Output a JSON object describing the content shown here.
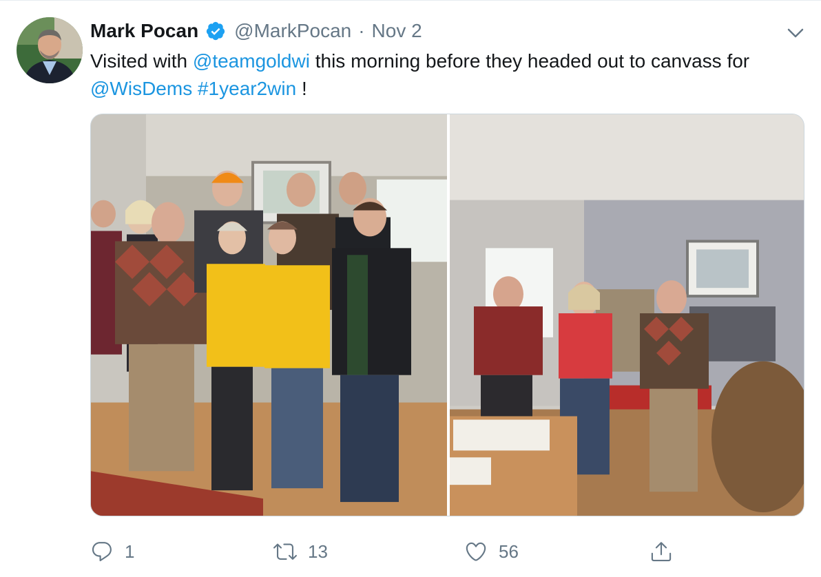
{
  "tweet": {
    "author_name": "Mark Pocan",
    "handle": "@MarkPocan",
    "separator": "·",
    "date": "Nov 2",
    "text": {
      "part1": "Visited with ",
      "mention1": "@teamgoldwi",
      "part2": " this morning before they headed out to canvass for ",
      "mention2": "@WisDems",
      "part3": " ",
      "hashtag": "#1year2win",
      "part4": " !"
    },
    "actions": {
      "replies": "1",
      "retweets": "13",
      "likes": "56"
    }
  },
  "icons": {
    "verified": "verified-badge-icon",
    "caret": "chevron-down-icon",
    "reply": "reply-icon",
    "retweet": "retweet-icon",
    "like": "heart-icon",
    "share": "share-icon"
  },
  "colors": {
    "link": "#1b95e0",
    "secondary_text": "#657786",
    "verified": "#1da1f2",
    "border": "#ccd6dd"
  }
}
